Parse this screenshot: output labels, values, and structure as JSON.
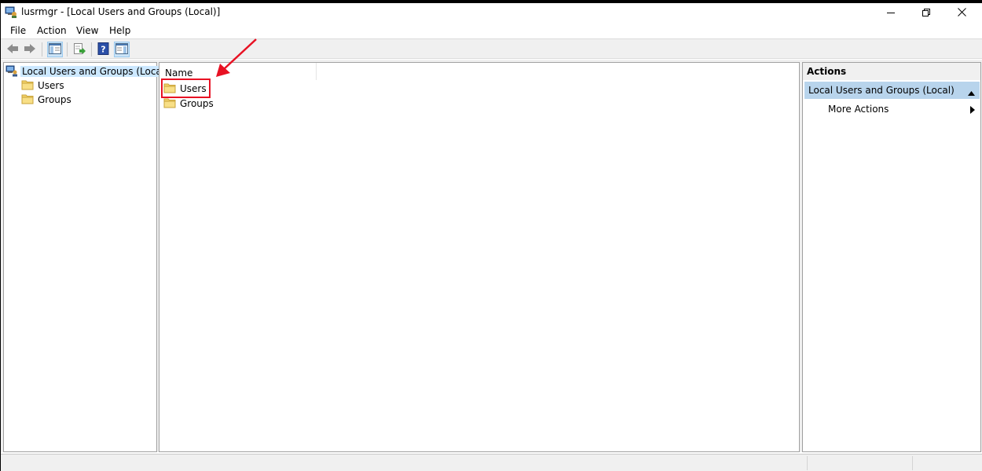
{
  "window": {
    "title": "lusrmgr - [Local Users and Groups (Local)]"
  },
  "menu": {
    "items": [
      "File",
      "Action",
      "View",
      "Help"
    ]
  },
  "tree": {
    "root": "Local Users and Groups (Local)",
    "children": [
      "Users",
      "Groups"
    ]
  },
  "list": {
    "column_name": "Name",
    "rows": [
      "Users",
      "Groups"
    ]
  },
  "actions": {
    "header": "Actions",
    "section": "Local Users and Groups (Local)",
    "more_actions": "More Actions"
  },
  "colors": {
    "highlight_box": "#e81123",
    "selection": "#cce8ff",
    "actions_section_bg": "#b8d4ec",
    "folder": "#f4d36a"
  },
  "icons": {
    "toolbar": [
      "back-arrow-icon",
      "forward-arrow-icon",
      "console-tree-icon",
      "export-list-icon",
      "help-icon",
      "action-pane-icon"
    ],
    "window_controls": [
      "minimize-icon",
      "restore-icon",
      "close-icon"
    ]
  }
}
